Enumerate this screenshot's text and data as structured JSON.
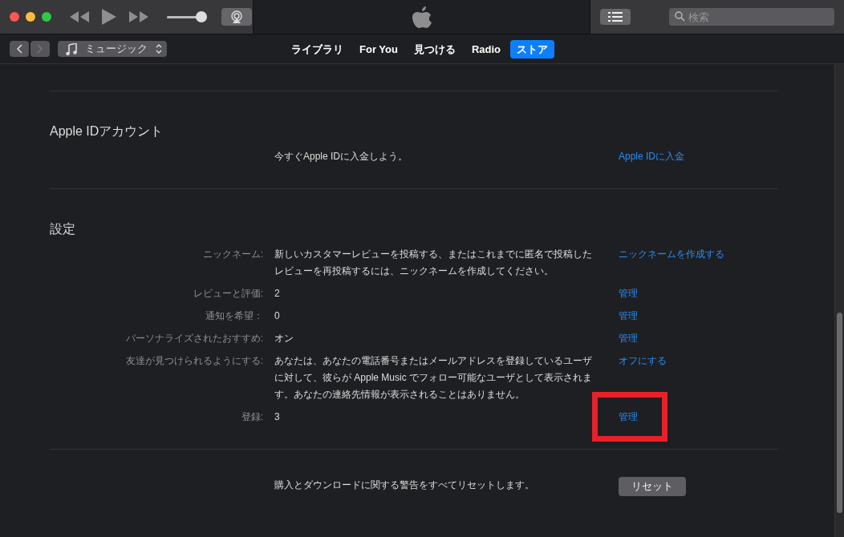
{
  "toolbar": {
    "volume": {
      "level": 0.85
    },
    "search": {
      "placeholder": "検索"
    }
  },
  "nav": {
    "media_picker": "ミュージック",
    "tabs": [
      {
        "label": "ライブラリ",
        "selected": false
      },
      {
        "label": "For You",
        "selected": false
      },
      {
        "label": "見つける",
        "selected": false
      },
      {
        "label": "Radio",
        "selected": false
      },
      {
        "label": "ストア",
        "selected": true
      }
    ]
  },
  "sections": [
    {
      "title": "Apple IDアカウント",
      "rows": [
        {
          "value": "今すぐApple IDに入金しよう。",
          "link": "Apple IDに入金",
          "highlighted": false
        }
      ]
    },
    {
      "title": "設定",
      "rows": [
        {
          "label": "ニックネーム:",
          "value": "新しいカスタマーレビューを投稿する、またはこれまでに匿名で投稿したレビューを再投稿するには、ニックネームを作成してください。",
          "link": "ニックネームを作成する",
          "highlighted": false
        },
        {
          "label": "レビューと評価:",
          "value": "2",
          "link": "管理",
          "highlighted": false
        },
        {
          "label": "通知を希望：",
          "value": "0",
          "link": "管理",
          "highlighted": false
        },
        {
          "label": "パーソナライズされたおすすめ:",
          "value": "オン",
          "link": "管理",
          "highlighted": false
        },
        {
          "label": "友達が見つけられるようにする:",
          "value": "あなたは、あなたの電話番号またはメールアドレスを登録しているユーザに対して、彼らが Apple Music でフォロー可能なユーザとして表示されます。あなたの連絡先情報が表示されることはありません。",
          "link": "オフにする",
          "highlighted": false
        },
        {
          "label": "登録:",
          "value": "3",
          "link": "管理",
          "highlighted": true
        }
      ]
    },
    {
      "rows": [
        {
          "value": "購入とダウンロードに関する警告をすべてリセットします。",
          "button": "リセット",
          "highlighted": false
        }
      ]
    }
  ]
}
